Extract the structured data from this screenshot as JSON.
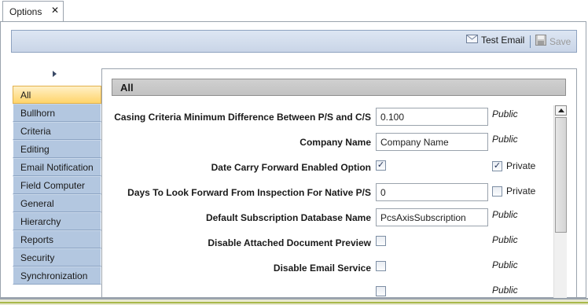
{
  "tab": {
    "label": "Options",
    "close": "✕"
  },
  "toolbar": {
    "test_email_label": "Test Email",
    "save_label": "Save"
  },
  "categories": [
    "All",
    "Bullhorn",
    "Criteria",
    "Editing",
    "Email Notification",
    "Field Computer",
    "General",
    "Hierarchy",
    "Reports",
    "Security",
    "Synchronization"
  ],
  "active_category": "All",
  "section_title": "All",
  "settings": [
    {
      "label": "Casing Criteria Minimum Difference Between P/S and C/S",
      "value": "0.100",
      "visibility": "Public"
    },
    {
      "label": "Company Name",
      "value": "Company Name",
      "visibility": "Public"
    },
    {
      "label": "Date Carry Forward Enabled Option",
      "checked": true,
      "private_checked": true,
      "private_label": "Private"
    },
    {
      "label": "Days To Look Forward From Inspection For Native P/S",
      "value": "0",
      "private_checked": false,
      "private_label": "Private"
    },
    {
      "label": "Default Subscription Database Name",
      "value": "PcsAxisSubscription",
      "visibility": "Public"
    },
    {
      "label": "Disable Attached Document Preview",
      "checked": false,
      "visibility": "Public"
    },
    {
      "label": "Disable Email Service",
      "checked": false,
      "visibility": "Public"
    },
    {
      "label": "",
      "checked": false,
      "visibility": "Public"
    }
  ],
  "icons": {
    "email": "envelope-icon",
    "save": "floppy-disk-icon",
    "expand": "expand-arrow-icon"
  },
  "colors": {
    "active_category": "#ffd46a",
    "category_bg": "#b3c7e0",
    "toolbar_bg": "#c9d5e7"
  }
}
